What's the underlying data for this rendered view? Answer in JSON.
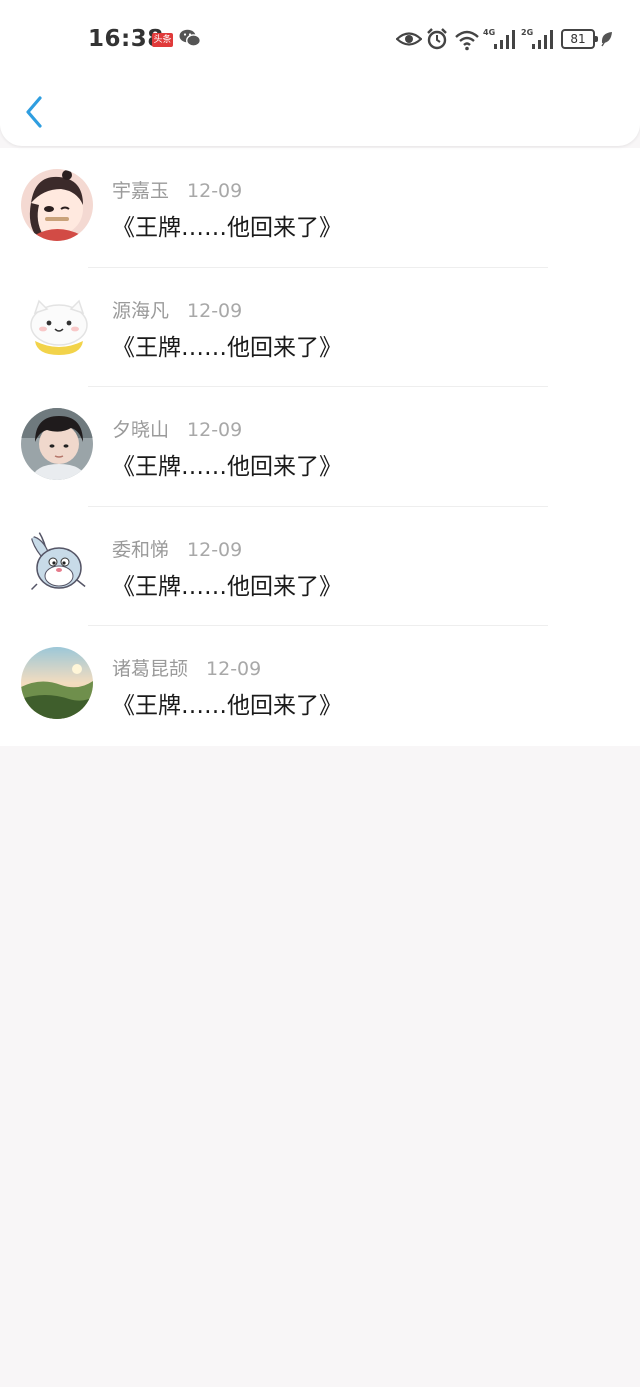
{
  "status_bar": {
    "time": "16:38",
    "app_badge": "头条",
    "net_4g": "4G",
    "net_2g": "2G",
    "battery": "81"
  },
  "colors": {
    "accent": "#2f9ee0",
    "background": "#f8f6f7"
  },
  "header": {
    "back_icon": "chevron-left-icon"
  },
  "comments": [
    {
      "name": "宇嘉玉",
      "date": "12-09",
      "text": "《王牌……他回来了》"
    },
    {
      "name": "源海凡",
      "date": "12-09",
      "text": "《王牌……他回来了》"
    },
    {
      "name": "夕晓山",
      "date": "12-09",
      "text": "《王牌……他回来了》"
    },
    {
      "name": "委和悌",
      "date": "12-09",
      "text": "《王牌……他回来了》"
    },
    {
      "name": "诸葛昆颉",
      "date": "12-09",
      "text": "《王牌……他回来了》"
    }
  ]
}
